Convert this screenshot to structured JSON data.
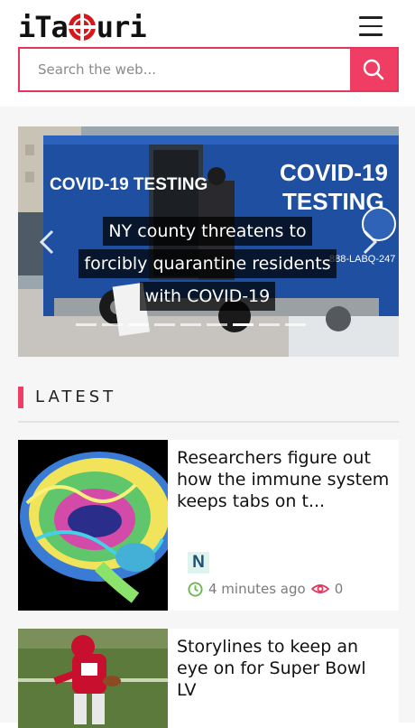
{
  "brand": {
    "logo_left": "iTa",
    "logo_right": "uri"
  },
  "search": {
    "placeholder": "Search the web..."
  },
  "carousel": {
    "caption_lines": [
      "NY county threatens to",
      "forcibly quarantine residents",
      "with COVID-19"
    ],
    "slide_count": 9,
    "active_slide_index": 6,
    "truck_text": {
      "left": "COVID-19 TESTING",
      "right_line1": "COVID-19",
      "right_line2": "TESTING",
      "phone": "888-LABQ-247"
    }
  },
  "section": {
    "title": "LATEST"
  },
  "articles": [
    {
      "title": "Researchers figure out how the immune system keeps tabs on t...",
      "source_initial": "N",
      "time": "4 minutes ago",
      "views": "0"
    },
    {
      "title": "Storylines to keep an eye on for Super Bowl LV"
    }
  ],
  "colors": {
    "accent": "#ef3d63",
    "logo_red": "#d4181c",
    "clock_green": "#6bb84f"
  }
}
